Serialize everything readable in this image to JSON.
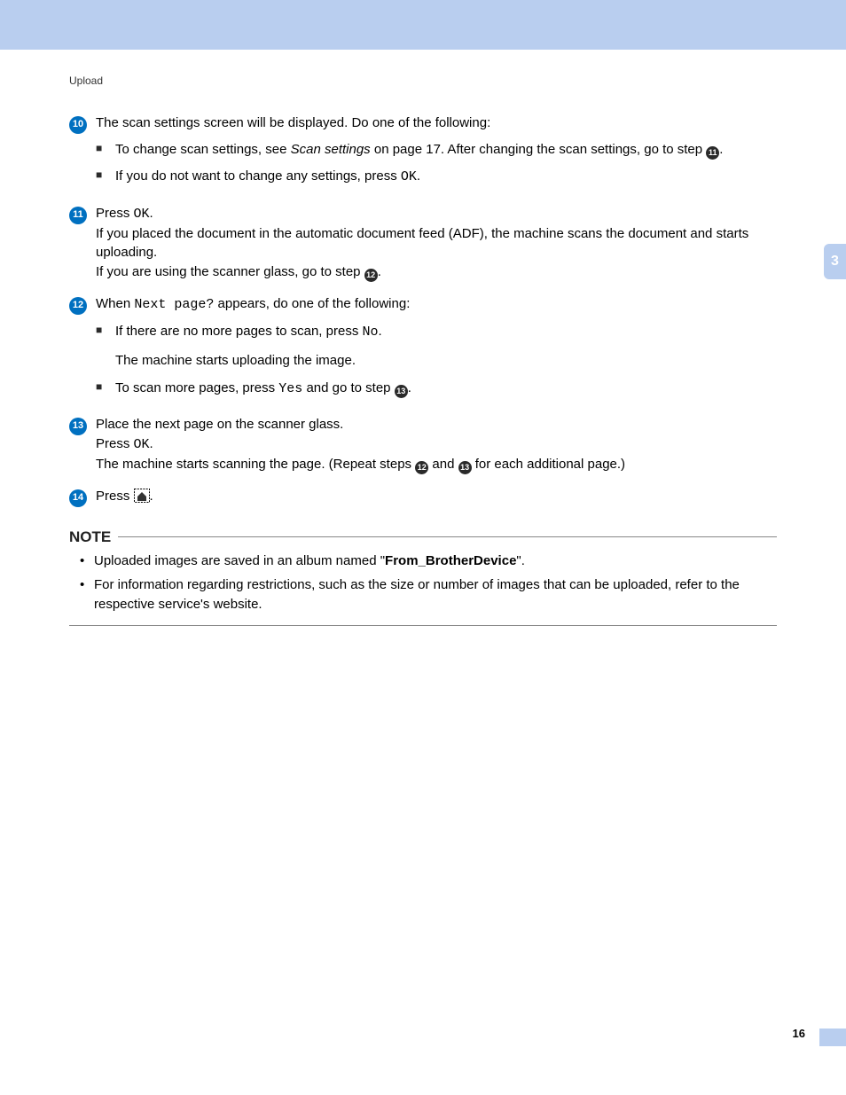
{
  "header": {
    "breadcrumb": "Upload"
  },
  "sideTab": "3",
  "pageNumber": "16",
  "steps": {
    "s10": {
      "num": "10",
      "text": "The scan settings screen will be displayed. Do one of the following:",
      "sub1_a": "To change scan settings, see ",
      "sub1_link": "Scan settings",
      "sub1_b": " on page 17. After changing the scan settings, go to step ",
      "sub1_ref": "11",
      "sub1_c": ".",
      "sub2_a": "If you do not want to change any settings, press ",
      "sub2_mono": "OK",
      "sub2_b": "."
    },
    "s11": {
      "num": "11",
      "line1_a": "Press ",
      "line1_mono": "OK",
      "line1_b": ".",
      "line2": "If you placed the document in the automatic document feed (ADF), the machine scans the document and starts uploading.",
      "line3_a": "If you are using the scanner glass, go to step ",
      "line3_ref": "12",
      "line3_b": "."
    },
    "s12": {
      "num": "12",
      "text_a": "When ",
      "text_mono": "Next page?",
      "text_b": " appears, do one of the following:",
      "sub1_a": "If there are no more pages to scan, press ",
      "sub1_mono": "No",
      "sub1_b": ".",
      "sub1_c": "The machine starts uploading the image.",
      "sub2_a": "To scan more pages, press ",
      "sub2_mono": "Yes",
      "sub2_b": " and go to step ",
      "sub2_ref": "13",
      "sub2_c": "."
    },
    "s13": {
      "num": "13",
      "line1": "Place the next page on the scanner glass.",
      "line2_a": "Press ",
      "line2_mono": "OK",
      "line2_b": ".",
      "line3_a": "The machine starts scanning the page. (Repeat steps ",
      "line3_ref1": "12",
      "line3_mid": " and ",
      "line3_ref2": "13",
      "line3_b": " for each additional page.)"
    },
    "s14": {
      "num": "14",
      "text_a": "Press ",
      "text_b": "."
    }
  },
  "note": {
    "title": "NOTE",
    "item1_a": "Uploaded images are saved in an album named \"",
    "item1_bold": "From_BrotherDevice",
    "item1_b": "\".",
    "item2": "For information regarding restrictions, such as the size or number of images that can be uploaded, refer to the respective service's website."
  }
}
